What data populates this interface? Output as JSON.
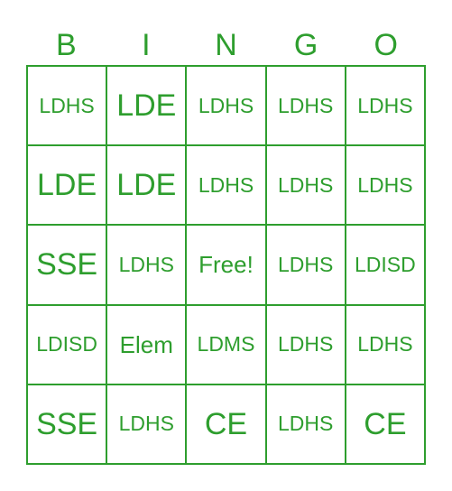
{
  "header": [
    "B",
    "I",
    "N",
    "G",
    "O"
  ],
  "colors": {
    "accent": "#2e9e2e"
  },
  "rows": [
    [
      "LDHS",
      "LDE",
      "LDHS",
      "LDHS",
      "LDHS"
    ],
    [
      "LDE",
      "LDE",
      "LDHS",
      "LDHS",
      "LDHS"
    ],
    [
      "SSE",
      "LDHS",
      "Free!",
      "LDHS",
      "LDISD"
    ],
    [
      "LDISD",
      "Elem",
      "LDMS",
      "LDHS",
      "LDHS"
    ],
    [
      "SSE",
      "LDHS",
      "CE",
      "LDHS",
      "CE"
    ]
  ]
}
